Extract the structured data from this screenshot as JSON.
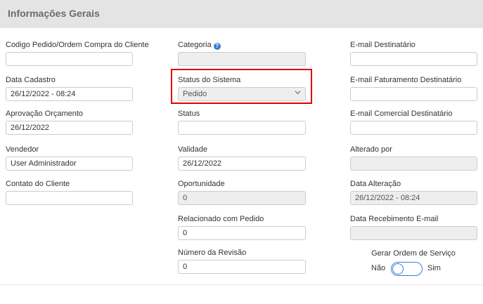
{
  "header": {
    "title": "Informações Gerais"
  },
  "col1": {
    "codigo_pedido": {
      "label": "Codigo Pedido/Ordem Compra do Cliente",
      "value": ""
    },
    "data_cadastro": {
      "label": "Data Cadastro",
      "value": "26/12/2022 - 08:24"
    },
    "aprovacao_orcamento": {
      "label": "Aprovação Orçamento",
      "value": "26/12/2022"
    },
    "vendedor": {
      "label": "Vendedor",
      "value": "User Administrador"
    },
    "contato_cliente": {
      "label": "Contato do Cliente",
      "value": ""
    }
  },
  "col2": {
    "categoria": {
      "label": "Categoria",
      "value": "",
      "help_icon": "question-circle-icon"
    },
    "status_sistema": {
      "label": "Status do Sistema",
      "value": "Pedido",
      "icon": "chevron-down-icon"
    },
    "status": {
      "label": "Status",
      "value": ""
    },
    "validade": {
      "label": "Validade",
      "value": "26/12/2022"
    },
    "oportunidade": {
      "label": "Oportunidade",
      "value": "0"
    },
    "relacionado_pedido": {
      "label": "Relacionado com Pedido",
      "value": "0"
    },
    "numero_revisao": {
      "label": "Número da Revisão",
      "value": "0"
    }
  },
  "col3": {
    "email_destinatario": {
      "label": "E-mail Destinatário",
      "value": ""
    },
    "email_faturamento": {
      "label": "E-mail Faturamento Destinatário",
      "value": ""
    },
    "email_comercial": {
      "label": "E-mail Comercial Destinatário",
      "value": ""
    },
    "alterado_por": {
      "label": "Alterado por",
      "value": ""
    },
    "data_alteracao": {
      "label": "Data Alteração",
      "value": "26/12/2022 - 08:24"
    },
    "data_recebimento": {
      "label": "Data Recebimento E-mail",
      "value": ""
    },
    "gerar_os": {
      "label": "Gerar Ordem de Serviço",
      "off_label": "Não",
      "on_label": "Sim",
      "checked": false
    }
  },
  "colors": {
    "accent": "#3a7bd5",
    "highlight": "#e00000",
    "header_bg": "#e4e4e4",
    "readonly_bg": "#eeeeee"
  }
}
